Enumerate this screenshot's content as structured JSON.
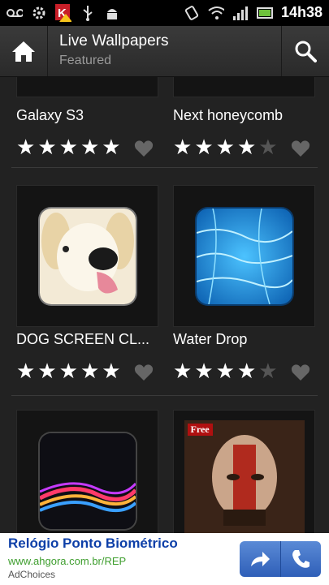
{
  "status_bar": {
    "time": "14h38",
    "icons": [
      "voicemail-icon",
      "settings-icon",
      "antivirus-warning-icon",
      "usb-icon",
      "android-debug-icon",
      "rotation-icon",
      "wifi-icon",
      "signal-icon",
      "battery-icon"
    ]
  },
  "action_bar": {
    "title": "Live Wallpapers",
    "subtitle": "Featured",
    "icons": [
      "home-icon",
      "search-icon"
    ]
  },
  "wallpapers": [
    {
      "name": "Galaxy S3",
      "rating": 5
    },
    {
      "name": "Next honeycomb",
      "rating": 4
    },
    {
      "name": "DOG SCREEN CL...",
      "rating": 5
    },
    {
      "name": "Water Drop",
      "rating": 4
    },
    {
      "name": "",
      "rating": null
    },
    {
      "name": "",
      "rating": null,
      "badge": "Free"
    }
  ],
  "ad": {
    "title": "Relógio Ponto Biométrico",
    "url": "www.ahgora.com.br/REP",
    "choices": "AdChoices",
    "icons": [
      "share-arrow-icon",
      "phone-icon"
    ]
  },
  "colors": {
    "background": "#1d1d1d",
    "ad_title": "#0d3fa8",
    "ad_url": "#3e9e2e",
    "ad_button": "#3a6ac6"
  }
}
